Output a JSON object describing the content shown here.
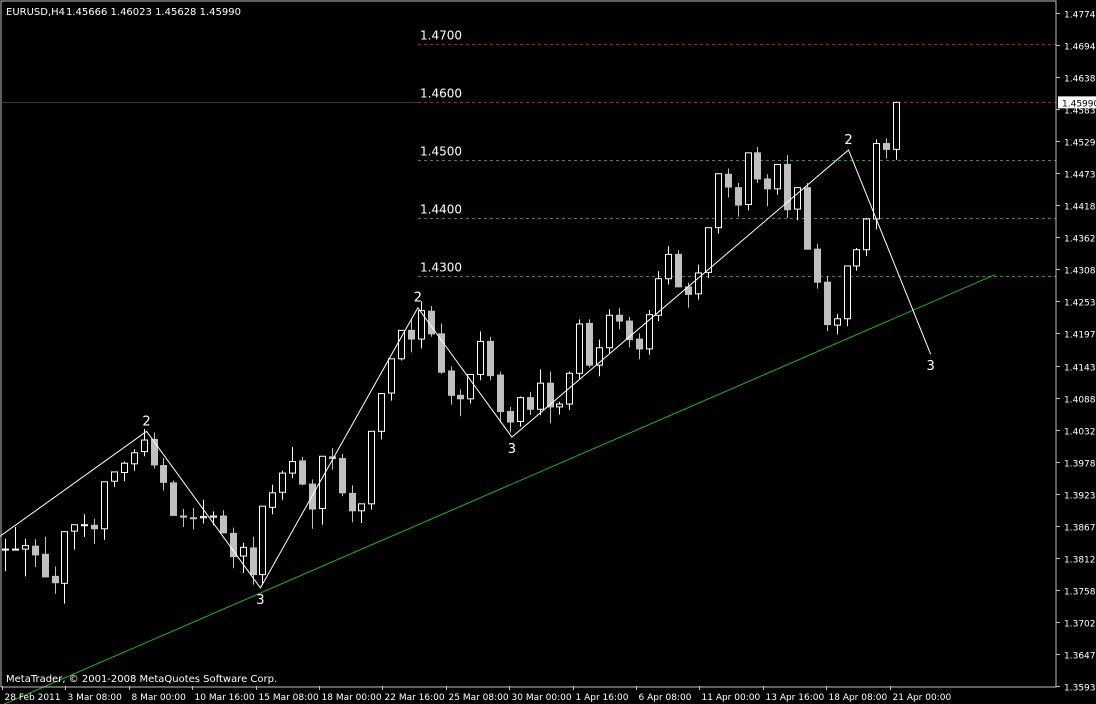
{
  "header": {
    "symbol": "EURUSD,H4",
    "ohlc": "1.45666 1.46023 1.45628 1.45990"
  },
  "footer": {
    "copyright": "MetaTrader, © 2001-2008 MetaQuotes Software Corp."
  },
  "colors": {
    "background": "#000000",
    "axis": "#c0c0c0",
    "bull_candle": "#ffffff",
    "bear_candle": "#c0c0c0",
    "red_level": "#b22222",
    "green_level": "#1f9e1f",
    "trendline": "#1fb31f",
    "zigzag": "#ffffff",
    "price_marker_bg": "#ffffff",
    "price_marker_text": "#000000"
  },
  "chart_data": {
    "type": "candlestick",
    "timeframe": "H4",
    "ylim": [
      1.3593,
      1.4772
    ],
    "y_ticks": [
      "1.47740",
      "1.46940",
      "1.46385",
      "1.45830",
      "1.45290",
      "1.44735",
      "1.44180",
      "1.43625",
      "1.43085",
      "1.42530",
      "1.41975",
      "1.41435",
      "1.40880",
      "1.40325",
      "1.39785",
      "1.39230",
      "1.38675",
      "1.38120",
      "1.37580",
      "1.37025",
      "1.36470",
      "1.35930"
    ],
    "x_ticks": [
      "28 Feb 2011",
      "3 Mar 08:00",
      "8 Mar 00:00",
      "10 Mar 16:00",
      "15 Mar 08:00",
      "18 Mar 00:00",
      "22 Mar 16:00",
      "25 Mar 08:00",
      "30 Mar 00:00",
      "1 Apr 16:00",
      "6 Apr 08:00",
      "11 Apr 00:00",
      "13 Apr 16:00",
      "18 Apr 08:00",
      "21 Apr 00:00"
    ],
    "current_price": "1.45990",
    "horizontal_levels": [
      {
        "label": "1.4700",
        "value": 1.47,
        "color": "red"
      },
      {
        "label": "1.4600",
        "value": 1.46,
        "color": "red"
      },
      {
        "label": "1.4500",
        "value": 1.45,
        "color": "green"
      },
      {
        "label": "1.4400",
        "value": 1.44,
        "color": "green"
      },
      {
        "label": "1.4300",
        "value": 1.43,
        "color": "green"
      }
    ],
    "trendline": {
      "from": [
        -1,
        1.3555
      ],
      "to": [
        100,
        1.4302
      ]
    },
    "zigzag": [
      {
        "i": -1,
        "price": 1.3845,
        "label": ""
      },
      {
        "i": 14.3,
        "price": 1.4032,
        "label": "2"
      },
      {
        "i": 25.8,
        "price": 1.3762,
        "label": "3"
      },
      {
        "i": 41.7,
        "price": 1.4245,
        "label": "2"
      },
      {
        "i": 51.2,
        "price": 1.4022,
        "label": "3"
      },
      {
        "i": 85.2,
        "price": 1.4517,
        "label": "2"
      },
      {
        "i": 93.5,
        "price": 1.4165,
        "label": "3"
      }
    ],
    "candles": [
      [
        1.3828,
        1.3847,
        1.3791,
        1.3829
      ],
      [
        1.3828,
        1.3867,
        1.3827,
        1.3829
      ],
      [
        1.3829,
        1.3847,
        1.3782,
        1.3835
      ],
      [
        1.3834,
        1.3846,
        1.3798,
        1.3819
      ],
      [
        1.382,
        1.385,
        1.3789,
        1.3781
      ],
      [
        1.3782,
        1.3799,
        1.3752,
        1.3771
      ],
      [
        1.377,
        1.3856,
        1.3735,
        1.3859
      ],
      [
        1.386,
        1.3869,
        1.3828,
        1.3871
      ],
      [
        1.387,
        1.3889,
        1.385,
        1.3871
      ],
      [
        1.387,
        1.3881,
        1.3838,
        1.3864
      ],
      [
        1.3864,
        1.3874,
        1.3845,
        1.3945
      ],
      [
        1.3946,
        1.396,
        1.3936,
        1.3962
      ],
      [
        1.3961,
        1.398,
        1.3946,
        1.3977
      ],
      [
        1.3976,
        1.4001,
        1.3964,
        1.3995
      ],
      [
        1.3997,
        1.4036,
        1.3989,
        1.4017
      ],
      [
        1.4018,
        1.403,
        1.3968,
        1.3974
      ],
      [
        1.3973,
        1.3986,
        1.393,
        1.3944
      ],
      [
        1.3943,
        1.3947,
        1.3887,
        1.3887
      ],
      [
        1.3886,
        1.3898,
        1.3867,
        1.3884
      ],
      [
        1.3883,
        1.39,
        1.3863,
        1.3882
      ],
      [
        1.3883,
        1.3914,
        1.3873,
        1.3885
      ],
      [
        1.3884,
        1.3894,
        1.387,
        1.3886
      ],
      [
        1.3886,
        1.3896,
        1.3856,
        1.3857
      ],
      [
        1.3856,
        1.3866,
        1.3796,
        1.3816
      ],
      [
        1.3817,
        1.384,
        1.3788,
        1.3832
      ],
      [
        1.3831,
        1.385,
        1.3768,
        1.3785
      ],
      [
        1.3785,
        1.3899,
        1.377,
        1.3903
      ],
      [
        1.3901,
        1.394,
        1.3889,
        1.3926
      ],
      [
        1.3927,
        1.3964,
        1.3914,
        1.396
      ],
      [
        1.396,
        1.4005,
        1.3951,
        1.398
      ],
      [
        1.3981,
        1.3988,
        1.3939,
        1.3941
      ],
      [
        1.3941,
        1.3949,
        1.3864,
        1.3898
      ],
      [
        1.3899,
        1.3987,
        1.3871,
        1.3989
      ],
      [
        1.3988,
        1.4003,
        1.3966,
        1.3985
      ],
      [
        1.3985,
        1.3993,
        1.392,
        1.3926
      ],
      [
        1.3925,
        1.3939,
        1.3875,
        1.3895
      ],
      [
        1.3895,
        1.3905,
        1.3874,
        1.3907
      ],
      [
        1.3907,
        1.4,
        1.3897,
        1.4032
      ],
      [
        1.4032,
        1.4092,
        1.4018,
        1.4097
      ],
      [
        1.4098,
        1.4155,
        1.4085,
        1.4157
      ],
      [
        1.4157,
        1.4205,
        1.4154,
        1.4206
      ],
      [
        1.4206,
        1.4227,
        1.4168,
        1.4191
      ],
      [
        1.4191,
        1.4256,
        1.4175,
        1.424
      ],
      [
        1.4239,
        1.4248,
        1.4195,
        1.42
      ],
      [
        1.42,
        1.4218,
        1.4131,
        1.4134
      ],
      [
        1.4136,
        1.4144,
        1.4078,
        1.4094
      ],
      [
        1.4094,
        1.4104,
        1.4058,
        1.4088
      ],
      [
        1.4088,
        1.4129,
        1.408,
        1.413
      ],
      [
        1.413,
        1.4204,
        1.412,
        1.4187
      ],
      [
        1.4187,
        1.4195,
        1.412,
        1.4128
      ],
      [
        1.4129,
        1.4135,
        1.4047,
        1.4066
      ],
      [
        1.4066,
        1.4074,
        1.403,
        1.4048
      ],
      [
        1.4049,
        1.4092,
        1.404,
        1.409
      ],
      [
        1.409,
        1.41,
        1.406,
        1.407
      ],
      [
        1.407,
        1.4139,
        1.406,
        1.4115
      ],
      [
        1.4115,
        1.4135,
        1.4046,
        1.4074
      ],
      [
        1.4074,
        1.4083,
        1.4061,
        1.4079
      ],
      [
        1.4079,
        1.4135,
        1.4069,
        1.4132
      ],
      [
        1.4132,
        1.4225,
        1.4122,
        1.4217
      ],
      [
        1.4218,
        1.4225,
        1.4142,
        1.4146
      ],
      [
        1.4146,
        1.419,
        1.4127,
        1.4176
      ],
      [
        1.4176,
        1.4242,
        1.4166,
        1.4232
      ],
      [
        1.4232,
        1.4245,
        1.4208,
        1.4222
      ],
      [
        1.4222,
        1.4229,
        1.4177,
        1.419
      ],
      [
        1.4191,
        1.4201,
        1.4156,
        1.4174
      ],
      [
        1.4174,
        1.4241,
        1.4164,
        1.4233
      ],
      [
        1.4232,
        1.4308,
        1.4222,
        1.4295
      ],
      [
        1.4295,
        1.4351,
        1.4285,
        1.4337
      ],
      [
        1.4337,
        1.4344,
        1.428,
        1.4281
      ],
      [
        1.4281,
        1.4288,
        1.4245,
        1.4268
      ],
      [
        1.4269,
        1.4319,
        1.4259,
        1.4305
      ],
      [
        1.4306,
        1.4377,
        1.4296,
        1.4383
      ],
      [
        1.4383,
        1.4446,
        1.4373,
        1.4476
      ],
      [
        1.4475,
        1.4485,
        1.4435,
        1.4453
      ],
      [
        1.4452,
        1.446,
        1.4402,
        1.4422
      ],
      [
        1.4423,
        1.4506,
        1.4413,
        1.4512
      ],
      [
        1.4512,
        1.4522,
        1.446,
        1.4467
      ],
      [
        1.4467,
        1.4475,
        1.442,
        1.445
      ],
      [
        1.445,
        1.4491,
        1.444,
        1.4492
      ],
      [
        1.4492,
        1.4508,
        1.44,
        1.4414
      ],
      [
        1.4415,
        1.4448,
        1.4396,
        1.4452
      ],
      [
        1.4452,
        1.446,
        1.4345,
        1.4346
      ],
      [
        1.4346,
        1.4355,
        1.4278,
        1.4289
      ],
      [
        1.4289,
        1.43,
        1.4205,
        1.4216
      ],
      [
        1.4215,
        1.4234,
        1.4199,
        1.4226
      ],
      [
        1.4226,
        1.4316,
        1.4213,
        1.4317
      ],
      [
        1.4317,
        1.4348,
        1.4309,
        1.4345
      ],
      [
        1.4345,
        1.44,
        1.4334,
        1.4398
      ],
      [
        1.4398,
        1.4535,
        1.438,
        1.4528
      ],
      [
        1.4528,
        1.4537,
        1.4502,
        1.4518
      ],
      [
        1.4518,
        1.46,
        1.45,
        1.4599
      ]
    ]
  }
}
